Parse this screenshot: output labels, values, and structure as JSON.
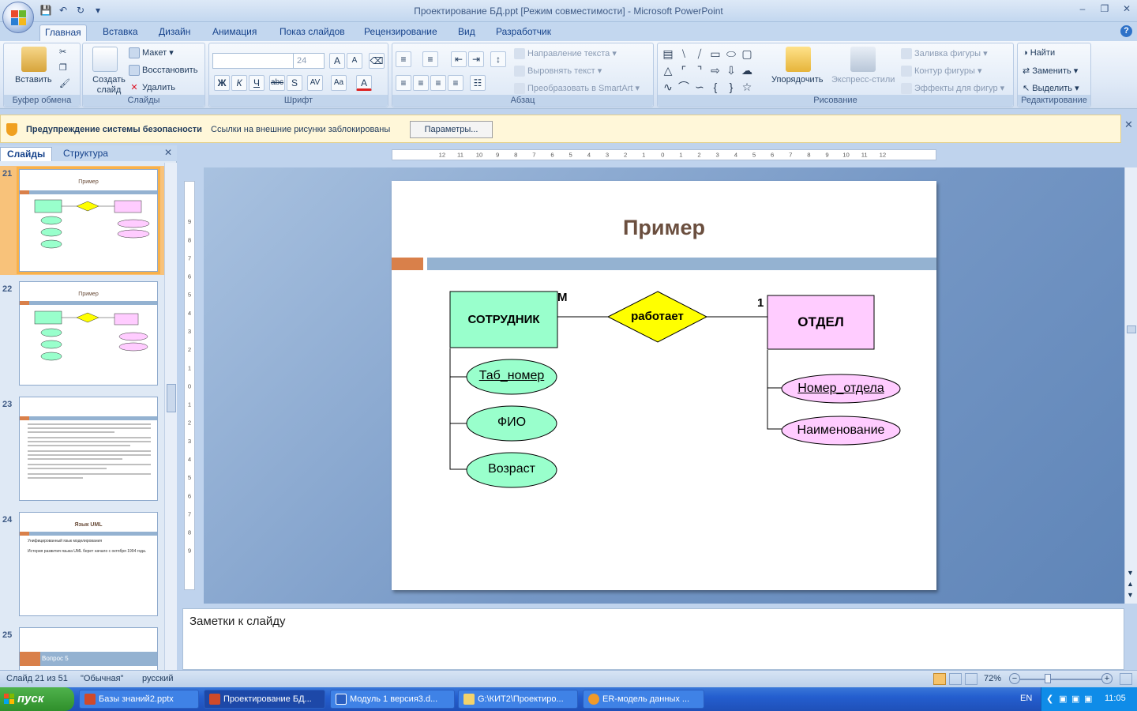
{
  "app": {
    "window_title": "Проектирование БД.ppt [Режим совместимости] - Microsoft PowerPoint"
  },
  "ribbon_tabs": [
    "Главная",
    "Вставка",
    "Дизайн",
    "Анимация",
    "Показ слайдов",
    "Рецензирование",
    "Вид",
    "Разработчик"
  ],
  "ribbon": {
    "clipboard": {
      "paste": "Вставить",
      "label": "Буфер обмена"
    },
    "slides": {
      "new_slide": "Создать слайд",
      "layout": "Макет",
      "reset": "Восстановить",
      "delete": "Удалить",
      "label": "Слайды"
    },
    "font": {
      "size": "24",
      "label": "Шрифт"
    },
    "paragraph": {
      "text_direction": "Направление текста",
      "align_text": "Выровнять текст",
      "smartart": "Преобразовать в SmartArt",
      "label": "Абзац"
    },
    "drawing": {
      "arrange": "Упорядочить",
      "quick_styles": "Экспресс-стили",
      "shape_fill": "Заливка фигуры",
      "shape_outline": "Контур фигуры",
      "shape_effects": "Эффекты для фигур",
      "label": "Рисование"
    },
    "editing": {
      "find": "Найти",
      "replace": "Заменить",
      "select": "Выделить",
      "label": "Редактирование"
    }
  },
  "security_bar": {
    "title": "Предупреждение системы безопасности",
    "message": "Ссылки на внешние рисунки заблокированы",
    "button": "Параметры..."
  },
  "left_panel": {
    "tabs": [
      "Слайды",
      "Структура"
    ],
    "thumbnails": [
      {
        "num": "21",
        "title": "Пример",
        "selected": true
      },
      {
        "num": "22",
        "title": "Пример",
        "selected": false
      },
      {
        "num": "23",
        "title": "",
        "selected": false
      },
      {
        "num": "24",
        "title": "Язык UML",
        "lines": [
          "Унифицированный язык моделирования",
          "История развития языка UML берет начало с октября 1994 года."
        ],
        "selected": false
      },
      {
        "num": "25",
        "title": "Вопрос 5",
        "selected": false
      }
    ]
  },
  "slide": {
    "title": "Пример",
    "er": {
      "entity1": "СОТРУДНИК",
      "relation": "работает",
      "entity2": "ОТДЕЛ",
      "card1": "М",
      "card2": "1",
      "attrs1": [
        "Таб_номер",
        "ФИО",
        "Возраст"
      ],
      "attrs2": [
        "Номер_отдела",
        "Наименование"
      ]
    },
    "colors": {
      "entity1": "#99ffcc",
      "entity2": "#ffccff",
      "relation": "#ffff00"
    }
  },
  "notes": {
    "placeholder": "Заметки к слайду"
  },
  "status": {
    "slide_counter": "Слайд 21 из 51",
    "theme": "\"Обычная\"",
    "language": "русский",
    "zoom": "72%"
  },
  "taskbar": {
    "start": "пуск",
    "items": [
      "Базы знаний2.pptx",
      "Проектирование БД...",
      "Модуль 1 версия3.d...",
      "G:\\КИТ2\\Проектиро...",
      "ER-модель данных ..."
    ],
    "lang": "EN",
    "clock": "11:05"
  }
}
